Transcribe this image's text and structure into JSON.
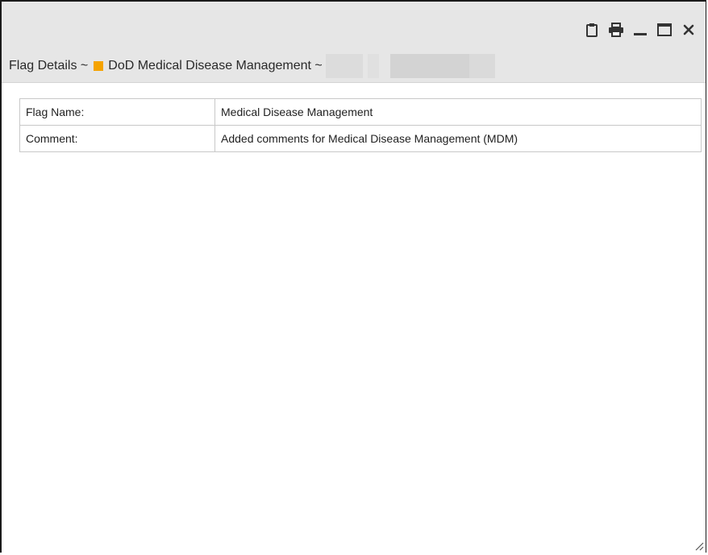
{
  "window": {
    "title": {
      "prefix": "Flag Details ~",
      "flag_name": "DoD Medical Disease Management ~",
      "flag_color": "#f5a300"
    },
    "controls": {
      "clipboard_icon": "clipboard-icon",
      "print_icon": "print-icon",
      "minimize_icon": "minimize-icon",
      "maximize_icon": "maximize-icon",
      "close_icon": "close-icon"
    }
  },
  "details": {
    "rows": [
      {
        "label": "Flag Name:",
        "value": "Medical Disease Management"
      },
      {
        "label": "Comment:",
        "value": "Added comments for Medical Disease Management (MDM)"
      }
    ]
  }
}
